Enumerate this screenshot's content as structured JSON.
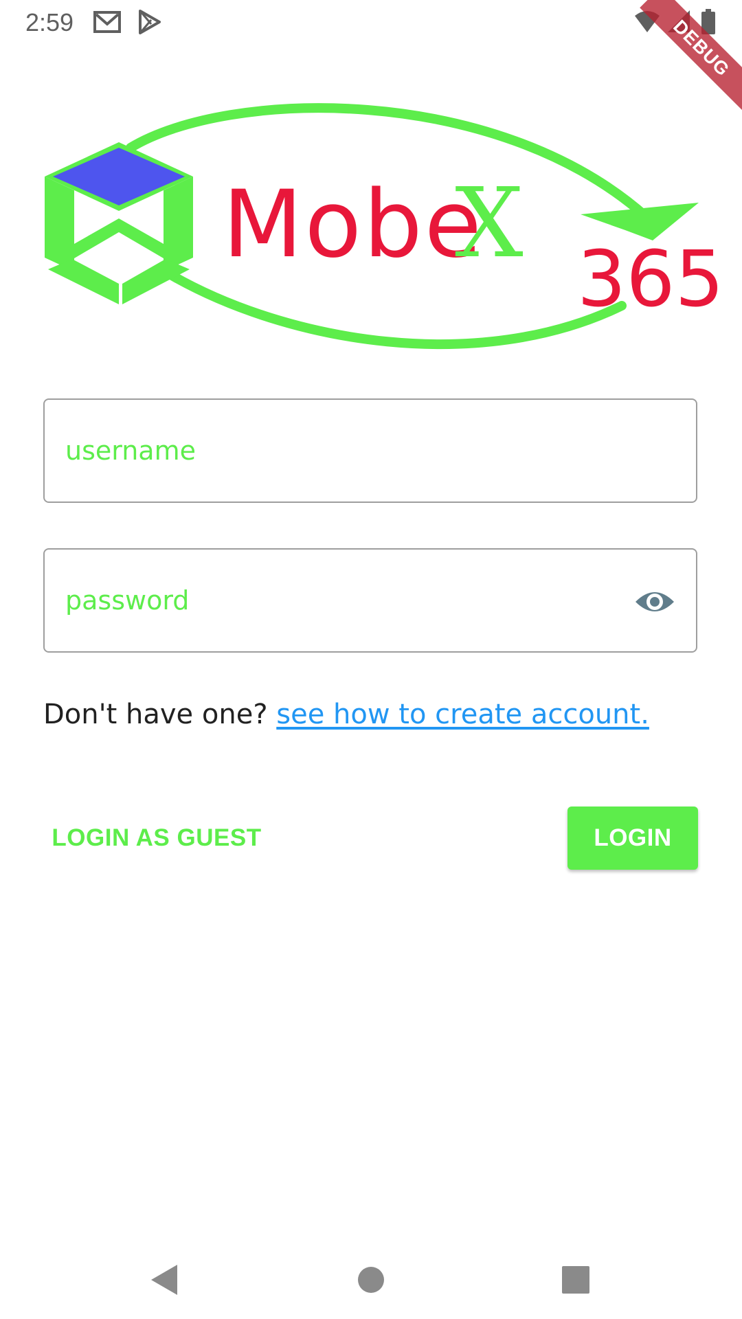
{
  "status_bar": {
    "time": "2:59",
    "icons": [
      "gmail-icon",
      "play-store-icon",
      "wifi-icon",
      "signal-icon",
      "battery-icon"
    ]
  },
  "debug_banner": {
    "label": "DEBUG"
  },
  "logo": {
    "word_red": "Mobe",
    "word_green": "X",
    "number": "365",
    "colors": {
      "green": "#5ded4b",
      "red": "#e8173a",
      "blue": "#4e55ee"
    }
  },
  "login_form": {
    "username_placeholder": "username",
    "username_value": "",
    "password_placeholder": "password",
    "password_value": "",
    "visibility_icon": "eye-icon"
  },
  "signup_prompt": {
    "text": "Don't have one? ",
    "link": "see how to create account."
  },
  "actions": {
    "guest_label": "LOGIN AS GUEST",
    "login_label": "LOGIN"
  },
  "theme": {
    "accent": "#5ded4b",
    "link": "#2196f3",
    "border": "#9e9e9e"
  },
  "nav_bar": {
    "buttons": [
      "back-icon",
      "home-icon",
      "recents-icon"
    ]
  }
}
